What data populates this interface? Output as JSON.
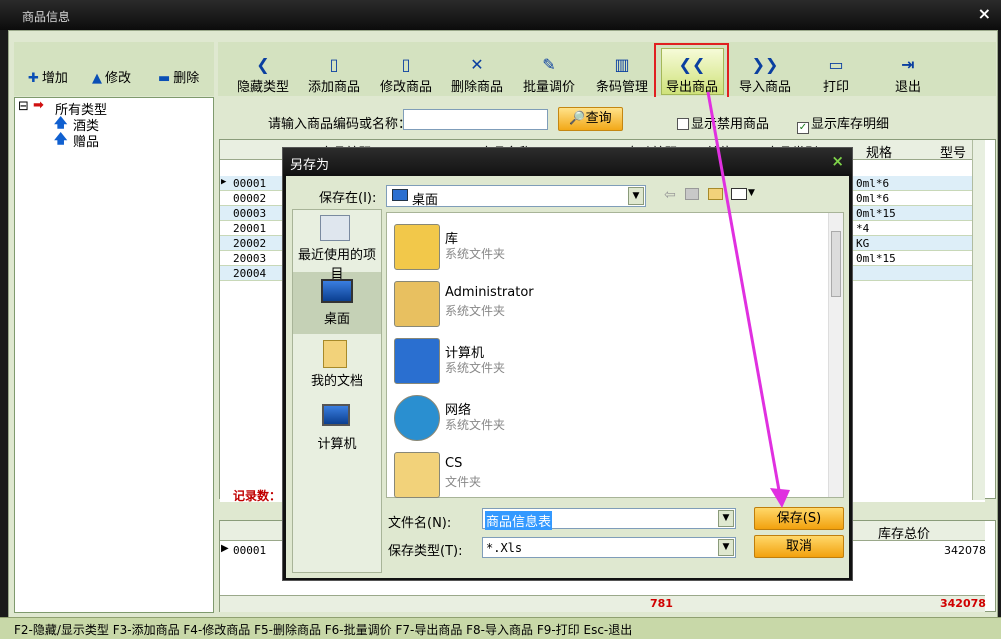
{
  "window": {
    "title": "商品信息",
    "close": "×"
  },
  "left_toolbar": {
    "add": "增加",
    "edit": "修改",
    "delete": "删除"
  },
  "toolbar": {
    "items": [
      "隐藏类型",
      "添加商品",
      "修改商品",
      "删除商品",
      "批量调价",
      "条码管理",
      "导出商品",
      "导入商品",
      "打印",
      "退出"
    ]
  },
  "tree": {
    "root": "所有类型",
    "children": [
      "酒类",
      "赠品"
    ],
    "expander": "⊟"
  },
  "search": {
    "label": "请输入商品编码或名称：",
    "value": "",
    "button": "查询",
    "show_disabled": "显示禁用商品",
    "show_stock": "显示库存明细",
    "show_disabled_checked": false,
    "show_stock_checked": true
  },
  "grid": {
    "headers": [
      "商品编码",
      "商品名称",
      "自动编码",
      "单位",
      "商品类别",
      "规格",
      "型号"
    ],
    "rows": [
      {
        "code": "00001",
        "spec": "0ml*6"
      },
      {
        "code": "00002",
        "spec": "0ml*6"
      },
      {
        "code": "00003",
        "spec": "0ml*15"
      },
      {
        "code": "20001",
        "spec": "*4"
      },
      {
        "code": "20002",
        "spec": "KG"
      },
      {
        "code": "20003",
        "spec": "0ml*15"
      },
      {
        "code": "20004",
        "spec": ""
      }
    ],
    "record_label": "记录数："
  },
  "subgrid": {
    "header_total": "库存总价",
    "row_code": "00001",
    "row_total": "342078",
    "sum_qty": "781",
    "sum_total": "342078"
  },
  "status_bar": "F2-隐藏/显示类型  F3-添加商品 F4-修改商品 F5-删除商品 F6-批量调价 F7-导出商品 F8-导入商品 F9-打印 Esc-退出",
  "dialog": {
    "title": "另存为",
    "close": "×",
    "save_in_label": "保存在(I):",
    "save_in_value": "桌面",
    "places": [
      "最近使用的项目",
      "桌面",
      "我的文档",
      "计算机"
    ],
    "files": [
      {
        "name": "库",
        "type": "系统文件夹"
      },
      {
        "name": "Administrator",
        "type": "系统文件夹"
      },
      {
        "name": "计算机",
        "type": "系统文件夹"
      },
      {
        "name": "网络",
        "type": "系统文件夹"
      },
      {
        "name": "CS",
        "type": "文件夹"
      }
    ],
    "filename_label": "文件名(N):",
    "filename_value": "商品信息表",
    "filetype_label": "保存类型(T):",
    "filetype_value": "*.Xls",
    "save_button": "保存(S)",
    "cancel_button": "取消"
  },
  "colors": {
    "accent_red": "#e02020",
    "arrow_magenta": "#e030e0",
    "button_orange": "#f2a818"
  }
}
